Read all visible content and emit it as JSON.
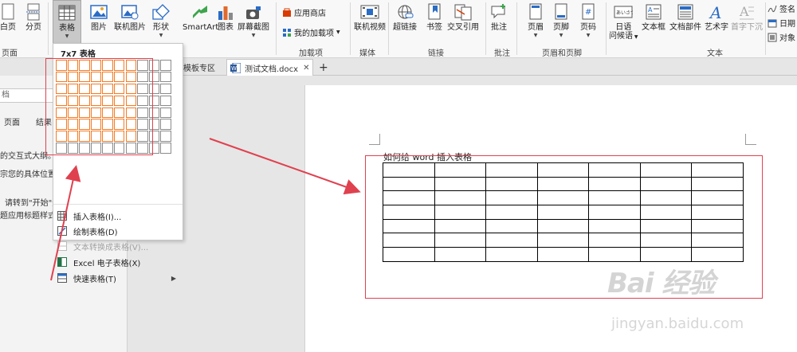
{
  "ribbon": {
    "buttons": {
      "blank_page": "白页",
      "page_break": "分页",
      "table": "表格",
      "picture": "图片",
      "online_picture": "联机图片",
      "shapes": "形状",
      "smartart": "SmartArt",
      "chart": "图表",
      "screenshot": "屏幕截图",
      "online_video": "联机视频",
      "hyperlink": "超链接",
      "bookmark": "书签",
      "cross_reference": "交叉引用",
      "comment": "批注",
      "header": "页眉",
      "footer": "页脚",
      "page_number": "页码",
      "japanese_greeting_1": "日语",
      "japanese_greeting_2": "问候语",
      "textbox": "文本框",
      "quick_parts": "文档部件",
      "wordart": "艺术字",
      "dropcap": "首字下沉",
      "store": "应用商店",
      "my_addins": "我的加载项",
      "signature": "签名",
      "date": "日期",
      "object": "对象"
    },
    "groups": {
      "pages": "页面",
      "addins": "加载项",
      "media": "媒体",
      "links": "链接",
      "comments": "批注",
      "header_footer": "页眉和页脚",
      "text": "文本"
    }
  },
  "tabs": {
    "template": "模板专区",
    "document": "测试文档.docx",
    "add": "+"
  },
  "navpane": {
    "search_text": "档",
    "tab_pages": "页面",
    "tab_results": "结果",
    "line1": "的交互式大纲。",
    "line2": "宗您的具体位置或",
    "line3": "请转到\"开始\"选",
    "line4": "题应用标题样式。"
  },
  "dropdown": {
    "header": "7x7 表格",
    "grid_rows": 8,
    "grid_cols": 10,
    "selected_rows": 7,
    "selected_cols": 7,
    "items": [
      {
        "label": "插入表格(I)...",
        "icon": "insert-table-icon",
        "disabled": false
      },
      {
        "label": "绘制表格(D)",
        "icon": "draw-table-icon",
        "disabled": false
      },
      {
        "label": "文本转换成表格(V)...",
        "icon": "text-to-table-icon",
        "disabled": true
      },
      {
        "label": "Excel 电子表格(X)",
        "icon": "excel-sheet-icon",
        "disabled": false
      },
      {
        "label": "快速表格(T)",
        "icon": "quick-table-icon",
        "disabled": false,
        "submenu": true
      }
    ]
  },
  "document": {
    "title": "如何给 word 插入表格",
    "table_rows": 7,
    "table_cols": 7
  },
  "watermark": {
    "brand": "Bai 经验",
    "url": "jingyan.baidu.com"
  },
  "colors": {
    "accent_orange": "#f37b25",
    "annotation_red": "#e0414f",
    "ribbon_bg": "#f8f8f8",
    "page_bg": "#ffffff"
  }
}
